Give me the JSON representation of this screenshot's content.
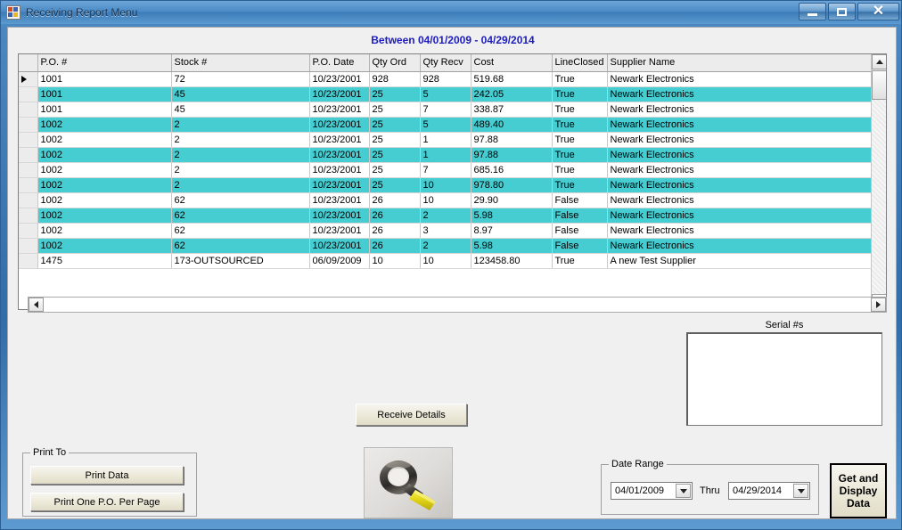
{
  "window": {
    "title": "Receiving Report Menu",
    "icon": "app-icon",
    "minimize_label": "",
    "maximize_label": "",
    "close_label": "✕"
  },
  "header": {
    "range_text": "Between 04/01/2009 - 04/29/2014",
    "range_color": "#1d1dbb"
  },
  "grid": {
    "columns": [
      {
        "key": "sel",
        "label": ""
      },
      {
        "key": "po",
        "label": "P.O. #"
      },
      {
        "key": "stock",
        "label": "Stock #"
      },
      {
        "key": "date",
        "label": "P.O. Date"
      },
      {
        "key": "ord",
        "label": "Qty Ord"
      },
      {
        "key": "recv",
        "label": "Qty Recv"
      },
      {
        "key": "cost",
        "label": "Cost"
      },
      {
        "key": "closed",
        "label": "LineClosed"
      },
      {
        "key": "supp",
        "label": "Supplier Name"
      }
    ],
    "selected_row_index": 0,
    "highlight_color": "#45cdd1",
    "rows": [
      {
        "po": "1001",
        "stock": "72",
        "date": "10/23/2001",
        "ord": "928",
        "recv": "928",
        "cost": "519.68",
        "closed": "True",
        "supp": "Newark Electronics",
        "alt": false
      },
      {
        "po": "1001",
        "stock": "45",
        "date": "10/23/2001",
        "ord": "25",
        "recv": "5",
        "cost": "242.05",
        "closed": "True",
        "supp": "Newark Electronics",
        "alt": true
      },
      {
        "po": "1001",
        "stock": "45",
        "date": "10/23/2001",
        "ord": "25",
        "recv": "7",
        "cost": "338.87",
        "closed": "True",
        "supp": "Newark Electronics",
        "alt": false
      },
      {
        "po": "1002",
        "stock": "2",
        "date": "10/23/2001",
        "ord": "25",
        "recv": "5",
        "cost": "489.40",
        "closed": "True",
        "supp": "Newark Electronics",
        "alt": true
      },
      {
        "po": "1002",
        "stock": "2",
        "date": "10/23/2001",
        "ord": "25",
        "recv": "1",
        "cost": "97.88",
        "closed": "True",
        "supp": "Newark Electronics",
        "alt": false
      },
      {
        "po": "1002",
        "stock": "2",
        "date": "10/23/2001",
        "ord": "25",
        "recv": "1",
        "cost": "97.88",
        "closed": "True",
        "supp": "Newark Electronics",
        "alt": true
      },
      {
        "po": "1002",
        "stock": "2",
        "date": "10/23/2001",
        "ord": "25",
        "recv": "7",
        "cost": "685.16",
        "closed": "True",
        "supp": "Newark Electronics",
        "alt": false
      },
      {
        "po": "1002",
        "stock": "2",
        "date": "10/23/2001",
        "ord": "25",
        "recv": "10",
        "cost": "978.80",
        "closed": "True",
        "supp": "Newark Electronics",
        "alt": true
      },
      {
        "po": "1002",
        "stock": "62",
        "date": "10/23/2001",
        "ord": "26",
        "recv": "10",
        "cost": "29.90",
        "closed": "False",
        "supp": "Newark Electronics",
        "alt": false
      },
      {
        "po": "1002",
        "stock": "62",
        "date": "10/23/2001",
        "ord": "26",
        "recv": "2",
        "cost": "5.98",
        "closed": "False",
        "supp": "Newark Electronics",
        "alt": true
      },
      {
        "po": "1002",
        "stock": "62",
        "date": "10/23/2001",
        "ord": "26",
        "recv": "3",
        "cost": "8.97",
        "closed": "False",
        "supp": "Newark Electronics",
        "alt": false
      },
      {
        "po": "1002",
        "stock": "62",
        "date": "10/23/2001",
        "ord": "26",
        "recv": "2",
        "cost": "5.98",
        "closed": "False",
        "supp": "Newark Electronics",
        "alt": true
      },
      {
        "po": "1475",
        "stock": "173-OUTSOURCED",
        "date": "06/09/2009",
        "ord": "10",
        "recv": "10",
        "cost": "123458.80",
        "closed": "True",
        "supp": "A new Test Supplier",
        "alt": false
      }
    ]
  },
  "serial": {
    "label": "Serial #s",
    "value": ""
  },
  "buttons": {
    "receive_details": "Receive Details",
    "get_and_display_data": [
      "Get and",
      "Display",
      "Data"
    ]
  },
  "print_group": {
    "title": "Print To",
    "print_data": "Print Data",
    "print_one_po": "Print One P.O. Per Page"
  },
  "date_group": {
    "title": "Date Range",
    "from_value": "04/01/2009",
    "thru_label": "Thru",
    "to_value": "04/29/2014"
  },
  "photo": {
    "alt": "yellow-ring-terminal-photo"
  }
}
